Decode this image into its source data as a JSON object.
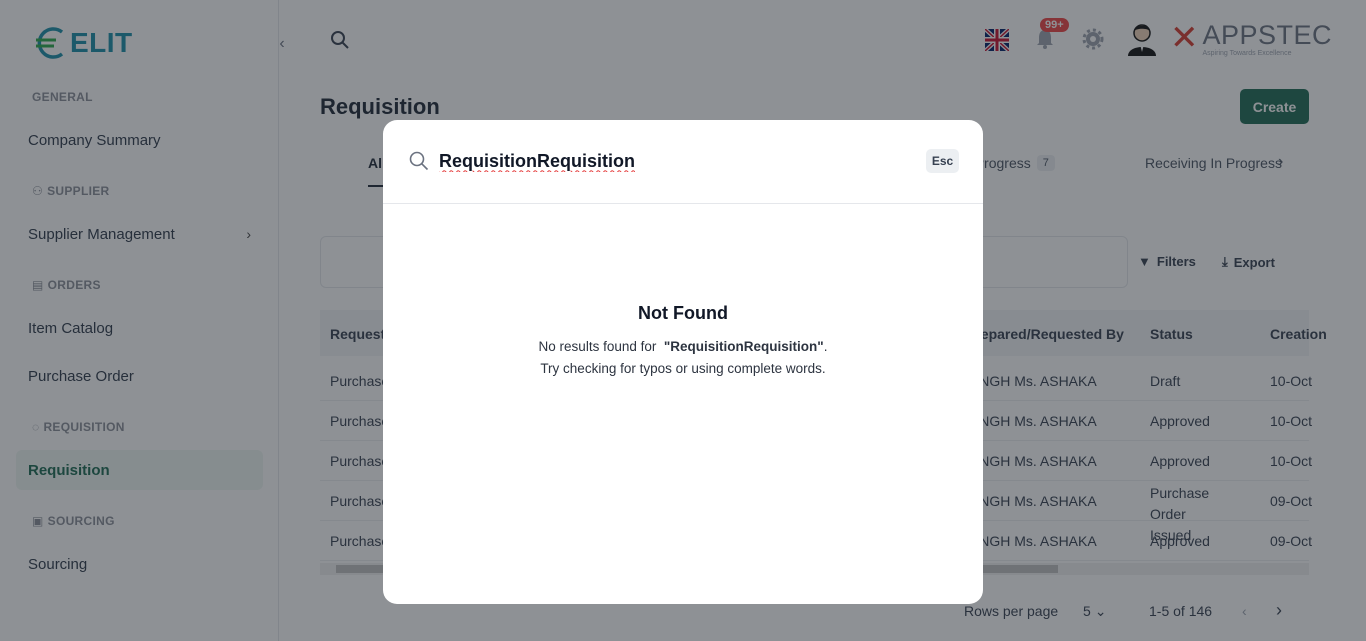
{
  "sidebar": {
    "logo_text": "ELIT",
    "sections": {
      "general": "GENERAL",
      "supplier": "SUPPLIER",
      "orders": "ORDERS",
      "requisition": "REQUISITION",
      "sourcing": "SOURCING"
    },
    "items": {
      "company_summary": "Company Summary",
      "supplier_management": "Supplier Management",
      "item_catalog": "Item Catalog",
      "purchase_order": "Purchase Order",
      "requisition": "Requisition",
      "sourcing": "Sourcing"
    }
  },
  "header": {
    "notification_count": "99+",
    "brand_name": "APPSTEC",
    "brand_tagline": "Aspiring Towards Excellence"
  },
  "main": {
    "title": "Requisition",
    "create_label": "Create",
    "tabs": [
      {
        "label": "All"
      },
      {
        "label": "Sourcing In Progress",
        "count": "7"
      },
      {
        "label": "Receiving In Progress"
      }
    ],
    "toolbar": {
      "filters_label": "Filters",
      "export_label": "Export"
    },
    "columns": [
      "Request",
      "Prepared/Requested By",
      "Status",
      "Creation"
    ],
    "rows": [
      {
        "name": "Purchase",
        "requester": "SINGH Ms. ASHAKA",
        "status": "Draft",
        "created": "10-Oct"
      },
      {
        "name": "Purchase",
        "requester": "SINGH Ms. ASHAKA",
        "status": "Approved",
        "created": "10-Oct"
      },
      {
        "name": "Purchase",
        "requester": "SINGH Ms. ASHAKA",
        "status": "Approved",
        "created": "10-Oct"
      },
      {
        "name": "Purchase",
        "requester": "SINGH Ms. ASHAKA",
        "status": "Purchase Order Issued",
        "created": "09-Oct"
      },
      {
        "name": "Purchase",
        "requester": "SINGH Ms. ASHAKA",
        "status": "Approved",
        "created": "09-Oct"
      }
    ],
    "pagination": {
      "rows_per_page_label": "Rows per page",
      "rows_per_page": "5",
      "range": "1-5 of 146"
    }
  },
  "search_modal": {
    "query": "RequisitionRequisition",
    "esc_label": "Esc",
    "not_found_title": "Not Found",
    "message_prefix": "No results found for",
    "message_query": "\"RequisitionRequisition\"",
    "message_suffix": ".",
    "hint": "Try checking for typos or using complete words."
  },
  "colors": {
    "primary": "#1e6b55",
    "logo": "#1b8ea8",
    "brand_red": "#d63a2f",
    "badge": "#ef4444"
  }
}
